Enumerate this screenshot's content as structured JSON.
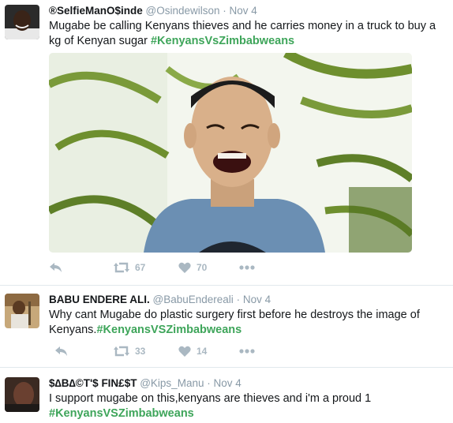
{
  "colors": {
    "hashtag": "#3ea55a",
    "meta": "#8899a6",
    "action": "#aab8c2",
    "divider": "#e1e8ed"
  },
  "tweets": [
    {
      "name": "®SelfieManO$inde",
      "handle": "@Osindewilson",
      "dot": "·",
      "time": "Nov 4",
      "text": "Mugabe be calling Kenyans thieves and he carries money in a truck to buy a kg of Kenyan sugar ",
      "hashtag": "#KenyansVsZimbabweans",
      "retweets": "67",
      "likes": "70",
      "icons": [
        "reply-icon",
        "retweet-icon",
        "like-icon",
        "more-icon"
      ]
    },
    {
      "name": "BABU ENDERE ALI.",
      "handle": "@BabuEndereali",
      "dot": "·",
      "time": "Nov 4",
      "text": "Why cant Mugabe do plastic surgery first before he destroys the image of Kenyans.",
      "hashtag": "#KenyansVSZimbabweans",
      "retweets": "33",
      "likes": "14",
      "icons": [
        "reply-icon",
        "retweet-icon",
        "like-icon",
        "more-icon"
      ]
    },
    {
      "name": "$∆B∆©T'$ FIN£$T",
      "handle": "@Kips_Manu",
      "dot": "·",
      "time": "Nov 4",
      "text": "I support mugabe on this,kenyans are thieves and i'm a proud 1",
      "hashtag": "#KenyansVSZimbabweans"
    }
  ]
}
